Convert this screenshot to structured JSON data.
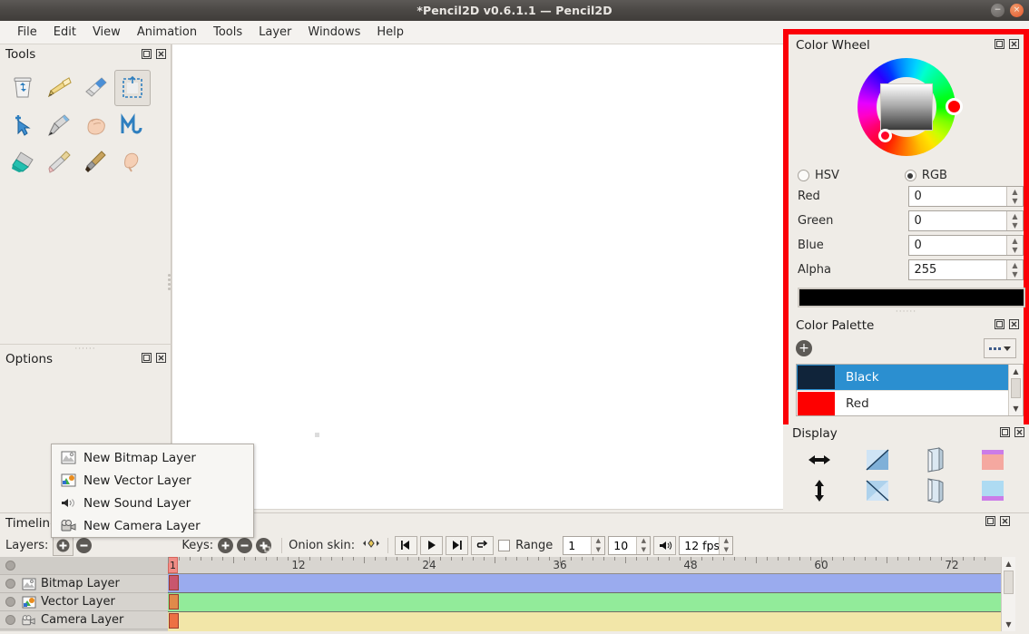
{
  "window": {
    "title": "*Pencil2D v0.6.1.1 — Pencil2D",
    "minimize_label": "−",
    "close_label": "×"
  },
  "menubar": {
    "items": [
      {
        "label": "File"
      },
      {
        "label": "Edit"
      },
      {
        "label": "View"
      },
      {
        "label": "Animation"
      },
      {
        "label": "Tools"
      },
      {
        "label": "Layer"
      },
      {
        "label": "Windows"
      },
      {
        "label": "Help"
      }
    ]
  },
  "tools_panel": {
    "title": "Tools",
    "float_icon": "float-icon",
    "close_icon": "close-icon",
    "tools": [
      {
        "name": "clear-tool",
        "icon": "trash-icon"
      },
      {
        "name": "pencil-tool",
        "icon": "pencil-icon"
      },
      {
        "name": "eraser-tool",
        "icon": "eraser-icon"
      },
      {
        "name": "select-tool",
        "icon": "select-rect-icon",
        "selected": true
      },
      {
        "name": "move-tool",
        "icon": "arrow-cursor-icon"
      },
      {
        "name": "pen-tool",
        "icon": "pen-nib-icon"
      },
      {
        "name": "hand-tool",
        "icon": "hand-icon"
      },
      {
        "name": "polyline-tool",
        "icon": "polyline-icon"
      },
      {
        "name": "bucket-tool",
        "icon": "paint-bucket-icon"
      },
      {
        "name": "eyedropper-tool",
        "icon": "eyedropper-icon"
      },
      {
        "name": "brush-tool",
        "icon": "brush-icon"
      },
      {
        "name": "smudge-tool",
        "icon": "smudge-finger-icon"
      }
    ]
  },
  "options_panel": {
    "title": "Options",
    "float_icon": "float-icon",
    "close_icon": "close-icon"
  },
  "color_wheel": {
    "title": "Color Wheel",
    "float_icon": "float-icon",
    "close_icon": "close-icon",
    "mode_hsv": "HSV",
    "mode_rgb": "RGB",
    "selected_mode": "RGB",
    "fields": [
      {
        "label": "Red",
        "value": "0"
      },
      {
        "label": "Green",
        "value": "0"
      },
      {
        "label": "Blue",
        "value": "0"
      },
      {
        "label": "Alpha",
        "value": "255"
      }
    ],
    "current_color": "#000000"
  },
  "color_palette": {
    "title": "Color Palette",
    "float_icon": "float-icon",
    "close_icon": "close-icon",
    "add_label": "+",
    "more_label": "...",
    "entries": [
      {
        "name": "Black",
        "color": "#10243a",
        "selected": true
      },
      {
        "name": "Red",
        "color": "#fe0000",
        "selected": false
      }
    ]
  },
  "display_panel": {
    "title": "Display",
    "float_icon": "float-icon",
    "close_icon": "close-icon",
    "buttons": [
      {
        "name": "flip-horizontal-icon"
      },
      {
        "name": "rotate-clockwise-icon"
      },
      {
        "name": "mirror-icon"
      },
      {
        "name": "overlay-pink-icon"
      },
      {
        "name": "flip-vertical-icon"
      },
      {
        "name": "rotate-counterclockwise-icon"
      },
      {
        "name": "mirror-vertical-icon"
      },
      {
        "name": "overlay-blue-icon"
      }
    ]
  },
  "timeline": {
    "title": "Timeline",
    "float_icon": "float-icon",
    "close_icon": "close-icon",
    "layers_label": "Layers:",
    "add_layer_label": "+",
    "remove_layer_label": "−",
    "keys_label": "Keys:",
    "add_key_label": "+",
    "remove_key_label": "−",
    "duplicate_key_label": "+",
    "onion_skin_label": "Onion skin:",
    "onion_icon": "onion-skin-icon",
    "play_prev_icon": "step-back-icon",
    "play_icon": "play-icon",
    "play_next_icon": "step-forward-icon",
    "loop_icon": "loop-icon",
    "range_label": "Range",
    "range_start": "1",
    "range_end": "10",
    "sound_icon": "sound-icon",
    "fps_value": "12 fps",
    "ruler_marks": [
      "12",
      "24",
      "36",
      "48",
      "60",
      "72"
    ],
    "current_frame": "1",
    "layers": [
      {
        "name": "",
        "icon": "",
        "track_color": "#f2e6a8",
        "empty_row": true
      },
      {
        "name": "Bitmap Layer",
        "icon": "bitmap-layer-icon",
        "track_color": "#9aabee",
        "key_color": "#c9566e"
      },
      {
        "name": "Vector Layer",
        "icon": "vector-layer-icon",
        "track_color": "#92eb9a",
        "key_color": "#e08a4a"
      },
      {
        "name": "Camera Layer",
        "icon": "camera-layer-icon",
        "track_color": "#f2e6a8",
        "key_color": "#ed7043"
      }
    ]
  },
  "context_menu": {
    "items": [
      {
        "label": "New Bitmap Layer",
        "icon": "bitmap-layer-icon"
      },
      {
        "label": "New Vector Layer",
        "icon": "vector-layer-icon"
      },
      {
        "label": "New Sound Layer",
        "icon": "sound-layer-icon"
      },
      {
        "label": "New Camera Layer",
        "icon": "camera-layer-icon"
      }
    ]
  },
  "colors": {
    "highlight_red": "#fb0007",
    "selection_blue": "#2b8fd0",
    "panel_bg": "#efece7"
  }
}
